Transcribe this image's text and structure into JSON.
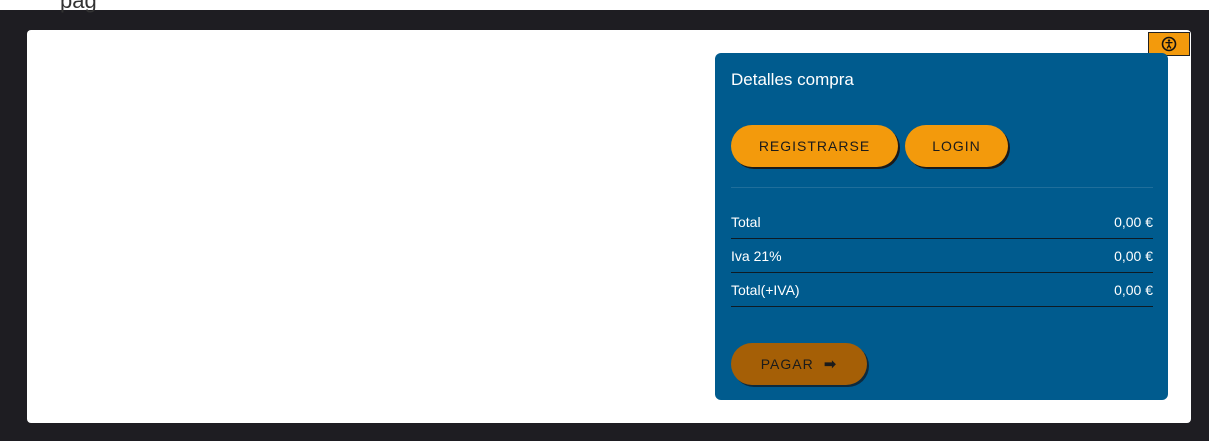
{
  "header": {
    "partial_text": "pág"
  },
  "accessibility": {
    "icon": "accessibility-icon"
  },
  "purchase_details": {
    "title": "Detalles compra",
    "register_label": "REGISTRARSE",
    "login_label": "LOGIN",
    "rows": [
      {
        "label": "Total",
        "value": "0,00 €"
      },
      {
        "label": "Iva 21%",
        "value": "0,00 €"
      },
      {
        "label": "Total(+IVA)",
        "value": "0,00 €"
      }
    ],
    "pay_label": "PAGAR",
    "pay_icon": "arrow-right-icon"
  },
  "colors": {
    "page_background": "#1e1d22",
    "panel_background": "#005b8e",
    "accent_orange": "#f39a0c",
    "pay_button": "#a55f06"
  }
}
